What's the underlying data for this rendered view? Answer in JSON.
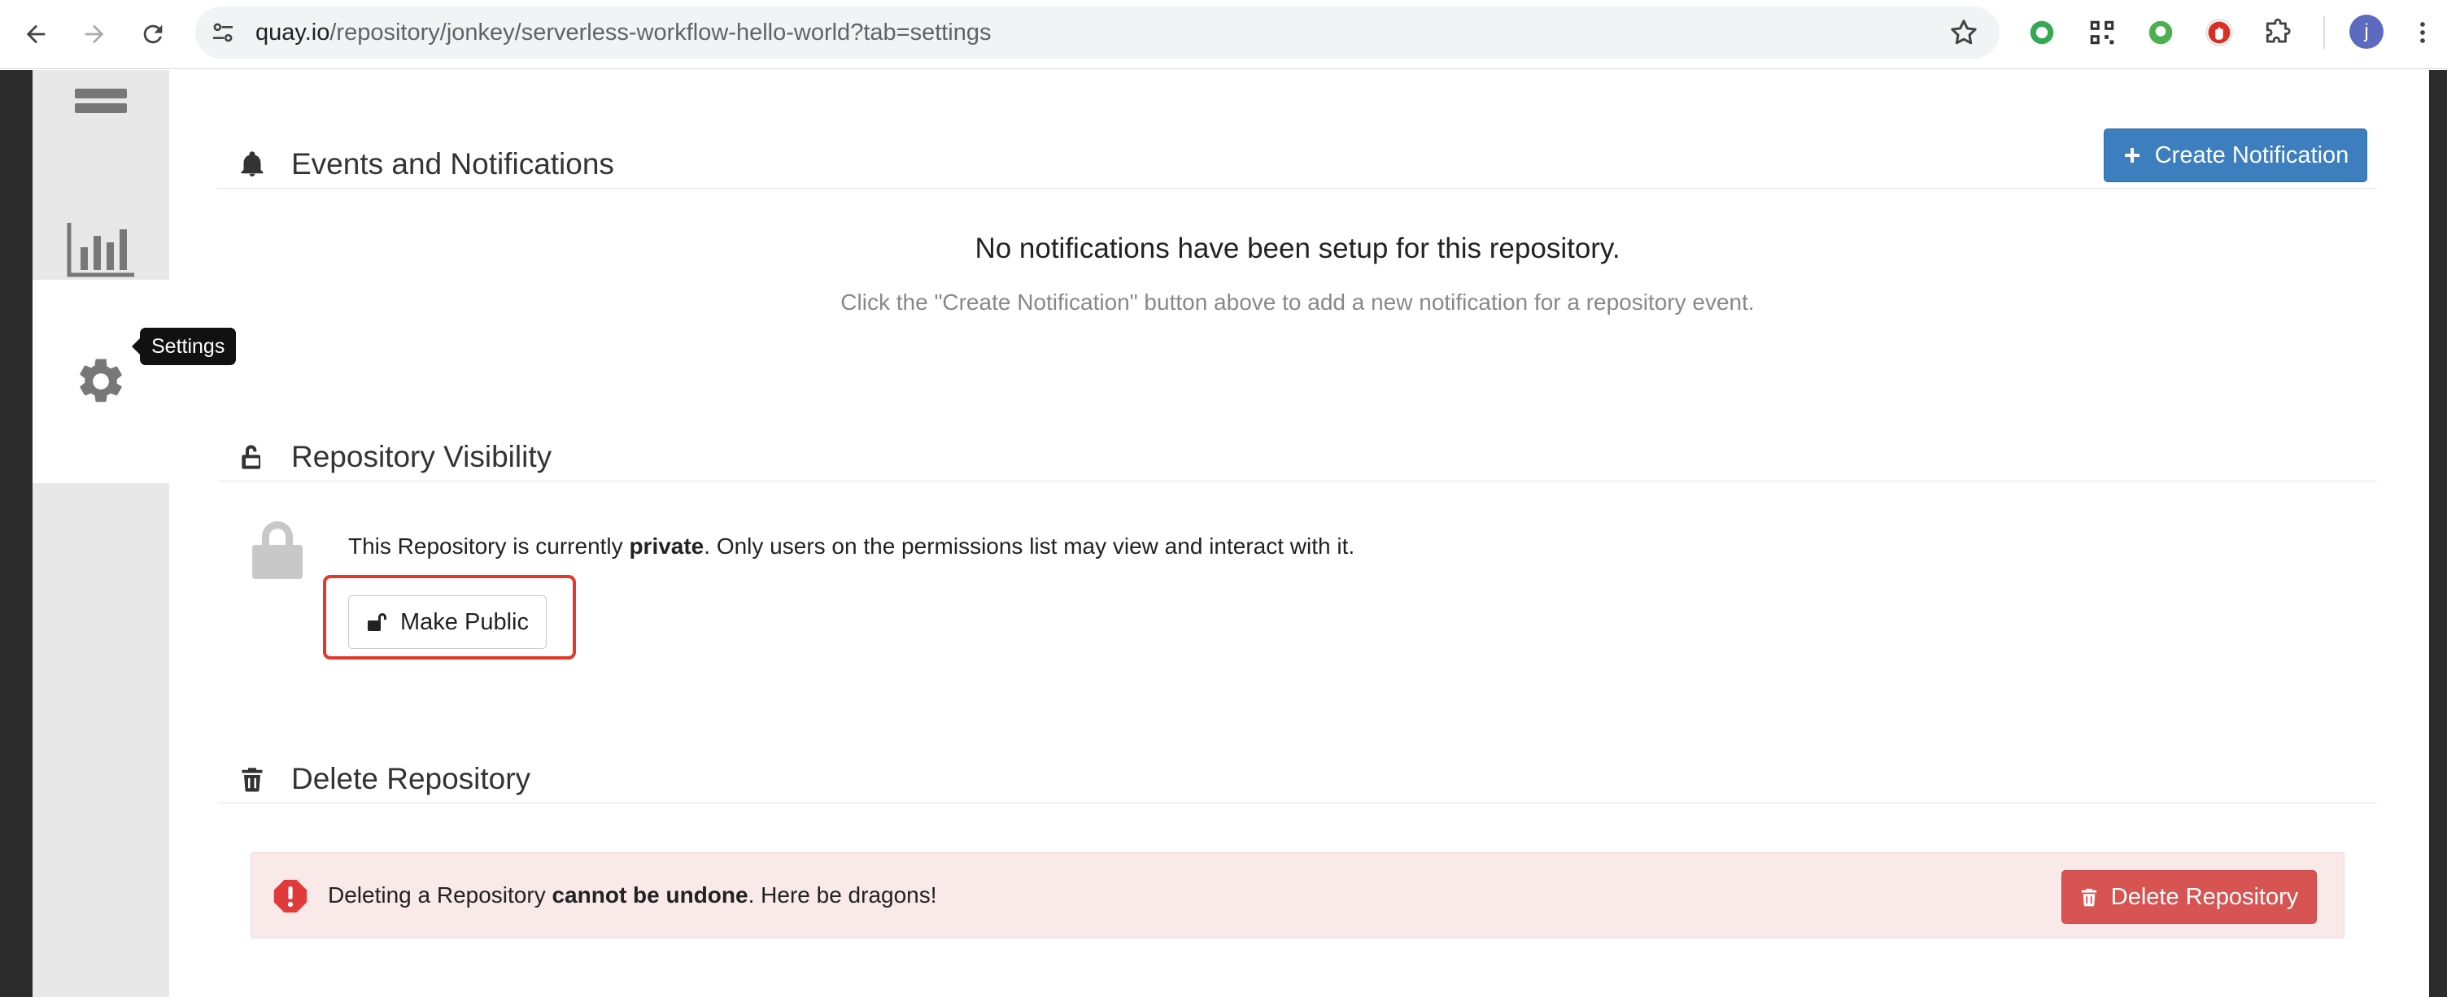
{
  "browser": {
    "url_host": "quay.io",
    "url_path": "/repository/jonkey/serverless-workflow-hello-world?tab=settings",
    "profile_initial": "j"
  },
  "sidebar": {
    "tooltip": "Settings",
    "items": [
      {
        "icon": "layers-icon"
      },
      {
        "icon": "bar-chart-icon"
      },
      {
        "icon": "gear-icon",
        "active": true
      }
    ]
  },
  "notifications": {
    "title": "Events and Notifications",
    "create_button": "Create Notification",
    "empty_title": "No notifications have been setup for this repository.",
    "empty_subtitle": "Click the \"Create Notification\" button above to add a new notification for a repository event."
  },
  "visibility": {
    "title": "Repository Visibility",
    "text_prefix": "This Repository is currently ",
    "status": "private",
    "text_suffix": ". Only users on the permissions list may view and interact with it.",
    "make_public_button": "Make Public"
  },
  "delete": {
    "title": "Delete Repository",
    "warning_prefix": "Deleting a Repository ",
    "warning_bold": "cannot be undone",
    "warning_suffix": ". Here be dragons!",
    "delete_button": "Delete Repository"
  },
  "colors": {
    "primary": "#3d7ebf",
    "danger": "#d75452",
    "highlight": "#e0382b",
    "alert_bg": "#f9e9e9"
  }
}
